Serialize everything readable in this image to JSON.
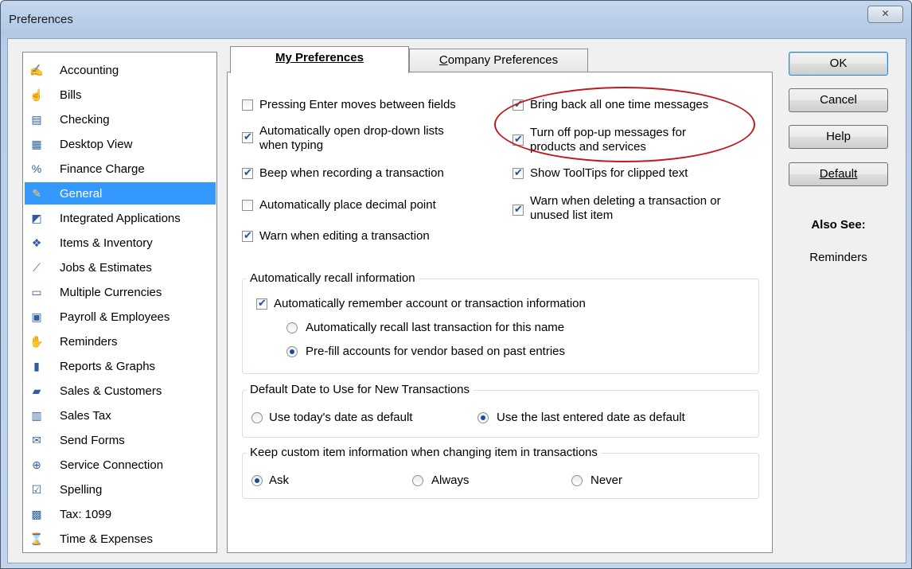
{
  "window": {
    "title": "Preferences",
    "close_glyph": "✕"
  },
  "categories": [
    {
      "label": "Accounting",
      "icon": "accounting-icon",
      "glyph": "✍"
    },
    {
      "label": "Bills",
      "icon": "bills-icon",
      "glyph": "☝"
    },
    {
      "label": "Checking",
      "icon": "checking-icon",
      "glyph": "▤"
    },
    {
      "label": "Desktop View",
      "icon": "desktop-view-icon",
      "glyph": "▦"
    },
    {
      "label": "Finance Charge",
      "icon": "finance-charge-icon",
      "glyph": "%"
    },
    {
      "label": "General",
      "icon": "general-icon",
      "glyph": "✎",
      "selected": true
    },
    {
      "label": "Integrated Applications",
      "icon": "integrated-applications-icon",
      "glyph": "◩"
    },
    {
      "label": "Items & Inventory",
      "icon": "items-inventory-icon",
      "glyph": "❖"
    },
    {
      "label": "Jobs & Estimates",
      "icon": "jobs-estimates-icon",
      "glyph": "⟋"
    },
    {
      "label": "Multiple Currencies",
      "icon": "multiple-currencies-icon",
      "glyph": "▭"
    },
    {
      "label": "Payroll & Employees",
      "icon": "payroll-employees-icon",
      "glyph": "▣"
    },
    {
      "label": "Reminders",
      "icon": "reminders-icon",
      "glyph": "✋"
    },
    {
      "label": "Reports & Graphs",
      "icon": "reports-graphs-icon",
      "glyph": "▮"
    },
    {
      "label": "Sales & Customers",
      "icon": "sales-customers-icon",
      "glyph": "▰"
    },
    {
      "label": "Sales Tax",
      "icon": "sales-tax-icon",
      "glyph": "▥"
    },
    {
      "label": "Send Forms",
      "icon": "send-forms-icon",
      "glyph": "✉"
    },
    {
      "label": "Service Connection",
      "icon": "service-connection-icon",
      "glyph": "⊕"
    },
    {
      "label": "Spelling",
      "icon": "spelling-icon",
      "glyph": "☑"
    },
    {
      "label": "Tax: 1099",
      "icon": "tax-1099-icon",
      "glyph": "▩"
    },
    {
      "label": "Time & Expenses",
      "icon": "time-expenses-icon",
      "glyph": "⌛"
    }
  ],
  "tabs": {
    "my": "My Preferences",
    "company": "Company Preferences"
  },
  "left_options": [
    {
      "text": "Pressing Enter moves between fields",
      "checked": false
    },
    {
      "text": "Automatically open drop-down lists",
      "text2": "when typing",
      "checked": true
    },
    {
      "text": "Beep when recording a transaction",
      "checked": true
    },
    {
      "text": "Automatically place decimal point",
      "checked": false
    },
    {
      "text": "Warn when editing a transaction",
      "checked": true
    }
  ],
  "right_options": [
    {
      "text": "Bring back all one time messages",
      "checked": true
    },
    {
      "text": "Turn off pop-up messages for",
      "text2": "products and services",
      "checked": true
    },
    {
      "text": "Show ToolTips for clipped text",
      "checked": true
    },
    {
      "text": "Warn when deleting a transaction or",
      "text2": "unused list item",
      "checked": true
    }
  ],
  "recall": {
    "title": "Automatically recall information",
    "checkbox": "Automatically remember account or transaction information",
    "checkbox_checked": true,
    "radio1": "Automatically recall last transaction for this name",
    "radio2": "Pre-fill accounts for vendor based on past entries",
    "selected": 2
  },
  "default_date": {
    "title": "Default Date to Use for New Transactions",
    "option1": "Use today's date as default",
    "option2": "Use the last entered date as default",
    "selected": 2
  },
  "custom_item": {
    "title": "Keep custom item information when changing item in transactions",
    "ask": "Ask",
    "always": "Always",
    "never": "Never",
    "selected": "Ask"
  },
  "buttons": {
    "ok": "OK",
    "cancel": "Cancel",
    "help": "Help",
    "default": "Default"
  },
  "also_see": {
    "title": "Also See:",
    "link": "Reminders"
  },
  "highlight_color": "#c0191f",
  "selection_color": "#3399ff"
}
